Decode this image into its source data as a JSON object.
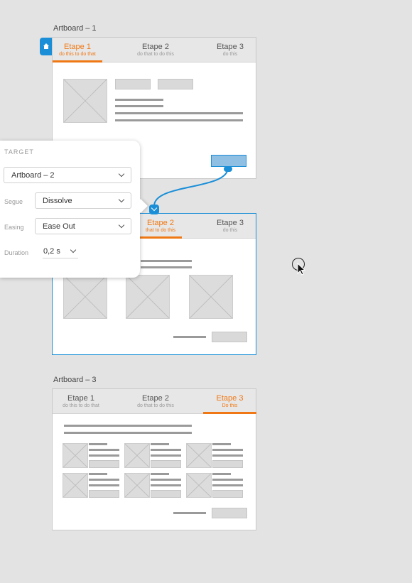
{
  "artboard1": {
    "title": "Artboard – 1",
    "tabs": [
      {
        "title": "Etape 1",
        "sub": "do this to do that"
      },
      {
        "title": "Etape 2",
        "sub": "do that to do this"
      },
      {
        "title": "Etape 3",
        "sub": "do this"
      }
    ]
  },
  "artboard2": {
    "tabs": [
      {
        "title": "Etape 2",
        "sub": "that to do this"
      },
      {
        "title": "Etape 3",
        "sub": "do this"
      }
    ]
  },
  "artboard3": {
    "title": "Artboard – 3",
    "tabs": [
      {
        "title": "Etape 1",
        "sub": "do this to do that"
      },
      {
        "title": "Etape 2",
        "sub": "do that to do this"
      },
      {
        "title": "Etape 3",
        "sub": "Do this"
      }
    ]
  },
  "panel": {
    "target_label": "TARGET",
    "target_value": "Artboard – 2",
    "segue_label": "Segue",
    "segue_value": "Dissolve",
    "easing_label": "Easing",
    "easing_value": "Ease Out",
    "duration_label": "Duration",
    "duration_value": "0,2 s"
  },
  "colors": {
    "accent": "#f07814",
    "link": "#1a8fd8",
    "hotspot": "#8fbfe3"
  }
}
